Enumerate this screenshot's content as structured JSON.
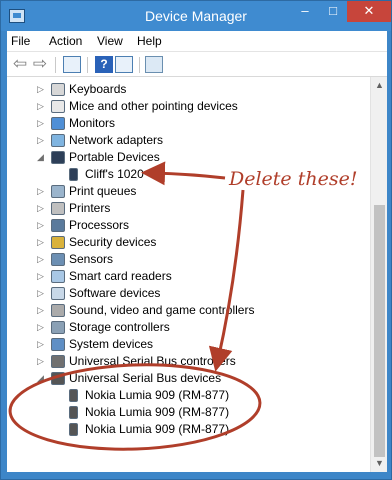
{
  "window": {
    "title": "Device Manager",
    "app_icon": "device-manager-icon",
    "controls": {
      "minimize": "–",
      "maximize": "□",
      "close": "✕"
    }
  },
  "menu": [
    "File",
    "Action",
    "View",
    "Help"
  ],
  "toolbar": [
    {
      "icon": "back-arrow-icon",
      "glyph": "⇦"
    },
    {
      "icon": "forward-arrow-icon",
      "glyph": "⇨"
    },
    {
      "icon": "show-hide-tree-icon",
      "glyph": ""
    },
    {
      "icon": "help-icon",
      "glyph": "?"
    },
    {
      "icon": "properties-icon",
      "glyph": ""
    },
    {
      "icon": "scan-hardware-icon",
      "glyph": ""
    }
  ],
  "tree": [
    {
      "label": "Keyboards",
      "expanded": false,
      "icon": "keyboard-icon"
    },
    {
      "label": "Mice and other pointing devices",
      "expanded": false,
      "icon": "mouse-icon"
    },
    {
      "label": "Monitors",
      "expanded": false,
      "icon": "monitor-icon"
    },
    {
      "label": "Network adapters",
      "expanded": false,
      "icon": "network-adapter-icon"
    },
    {
      "label": "Portable Devices",
      "expanded": true,
      "icon": "portable-device-icon"
    },
    {
      "label": "Cliff's 1020",
      "child": true,
      "icon": "phone-icon"
    },
    {
      "label": "Print queues",
      "expanded": false,
      "icon": "print-queue-icon"
    },
    {
      "label": "Printers",
      "expanded": false,
      "icon": "printer-icon"
    },
    {
      "label": "Processors",
      "expanded": false,
      "icon": "processor-icon"
    },
    {
      "label": "Security devices",
      "expanded": false,
      "icon": "security-device-icon"
    },
    {
      "label": "Sensors",
      "expanded": false,
      "icon": "sensor-icon"
    },
    {
      "label": "Smart card readers",
      "expanded": false,
      "icon": "smart-card-reader-icon"
    },
    {
      "label": "Software devices",
      "expanded": false,
      "icon": "software-device-icon"
    },
    {
      "label": "Sound, video and game controllers",
      "expanded": false,
      "icon": "sound-icon"
    },
    {
      "label": "Storage controllers",
      "expanded": false,
      "icon": "storage-controller-icon"
    },
    {
      "label": "System devices",
      "expanded": false,
      "icon": "system-device-icon"
    },
    {
      "label": "Universal Serial Bus controllers",
      "expanded": false,
      "icon": "usb-controller-icon"
    },
    {
      "label": "Universal Serial Bus devices",
      "expanded": true,
      "icon": "usb-device-icon"
    },
    {
      "label": "Nokia Lumia 909 (RM-877)",
      "child": true,
      "icon": "usb-plug-icon"
    },
    {
      "label": "Nokia Lumia 909 (RM-877)",
      "child": true,
      "icon": "usb-plug-icon"
    },
    {
      "label": "Nokia Lumia 909 (RM-877)",
      "child": true,
      "icon": "usb-plug-icon"
    }
  ],
  "annotation": {
    "text": "Delete these!",
    "color": "#b03e2a"
  },
  "colors": {
    "titlebar": "#3f8bd0",
    "close": "#c7453b",
    "annotation": "#b03e2a"
  }
}
